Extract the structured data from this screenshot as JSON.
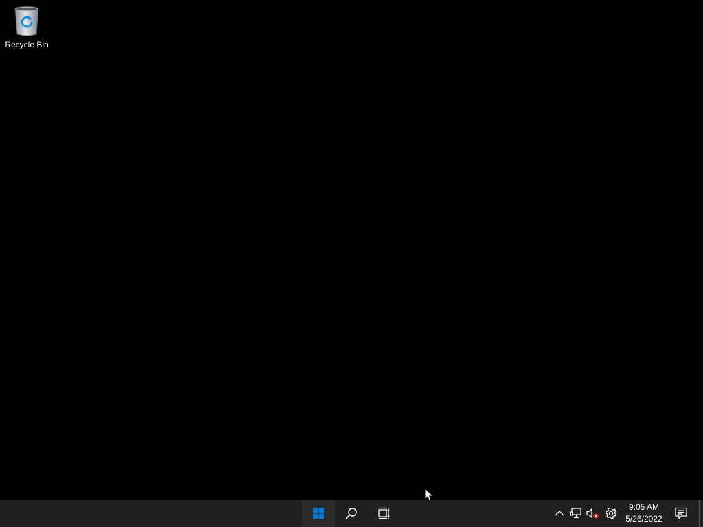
{
  "desktop": {
    "background_color": "#000000",
    "icons": [
      {
        "label": "Recycle Bin",
        "icon": "recycle-bin-icon"
      }
    ]
  },
  "taskbar": {
    "background_color": "#202020",
    "start_button": {
      "icon": "windows-logo-icon",
      "accent": "#0078d4"
    },
    "search_button": {
      "icon": "search-icon"
    },
    "task_view_button": {
      "icon": "task-view-icon"
    },
    "tray": {
      "overflow_icon": "chevron-up-icon",
      "network_icon": "network-icon",
      "volume_icon": "volume-muted-icon",
      "settings_icon": "gear-icon",
      "notification_icon": "notification-center-icon"
    },
    "clock": {
      "time": "9:05 AM",
      "date": "5/26/2022"
    }
  }
}
